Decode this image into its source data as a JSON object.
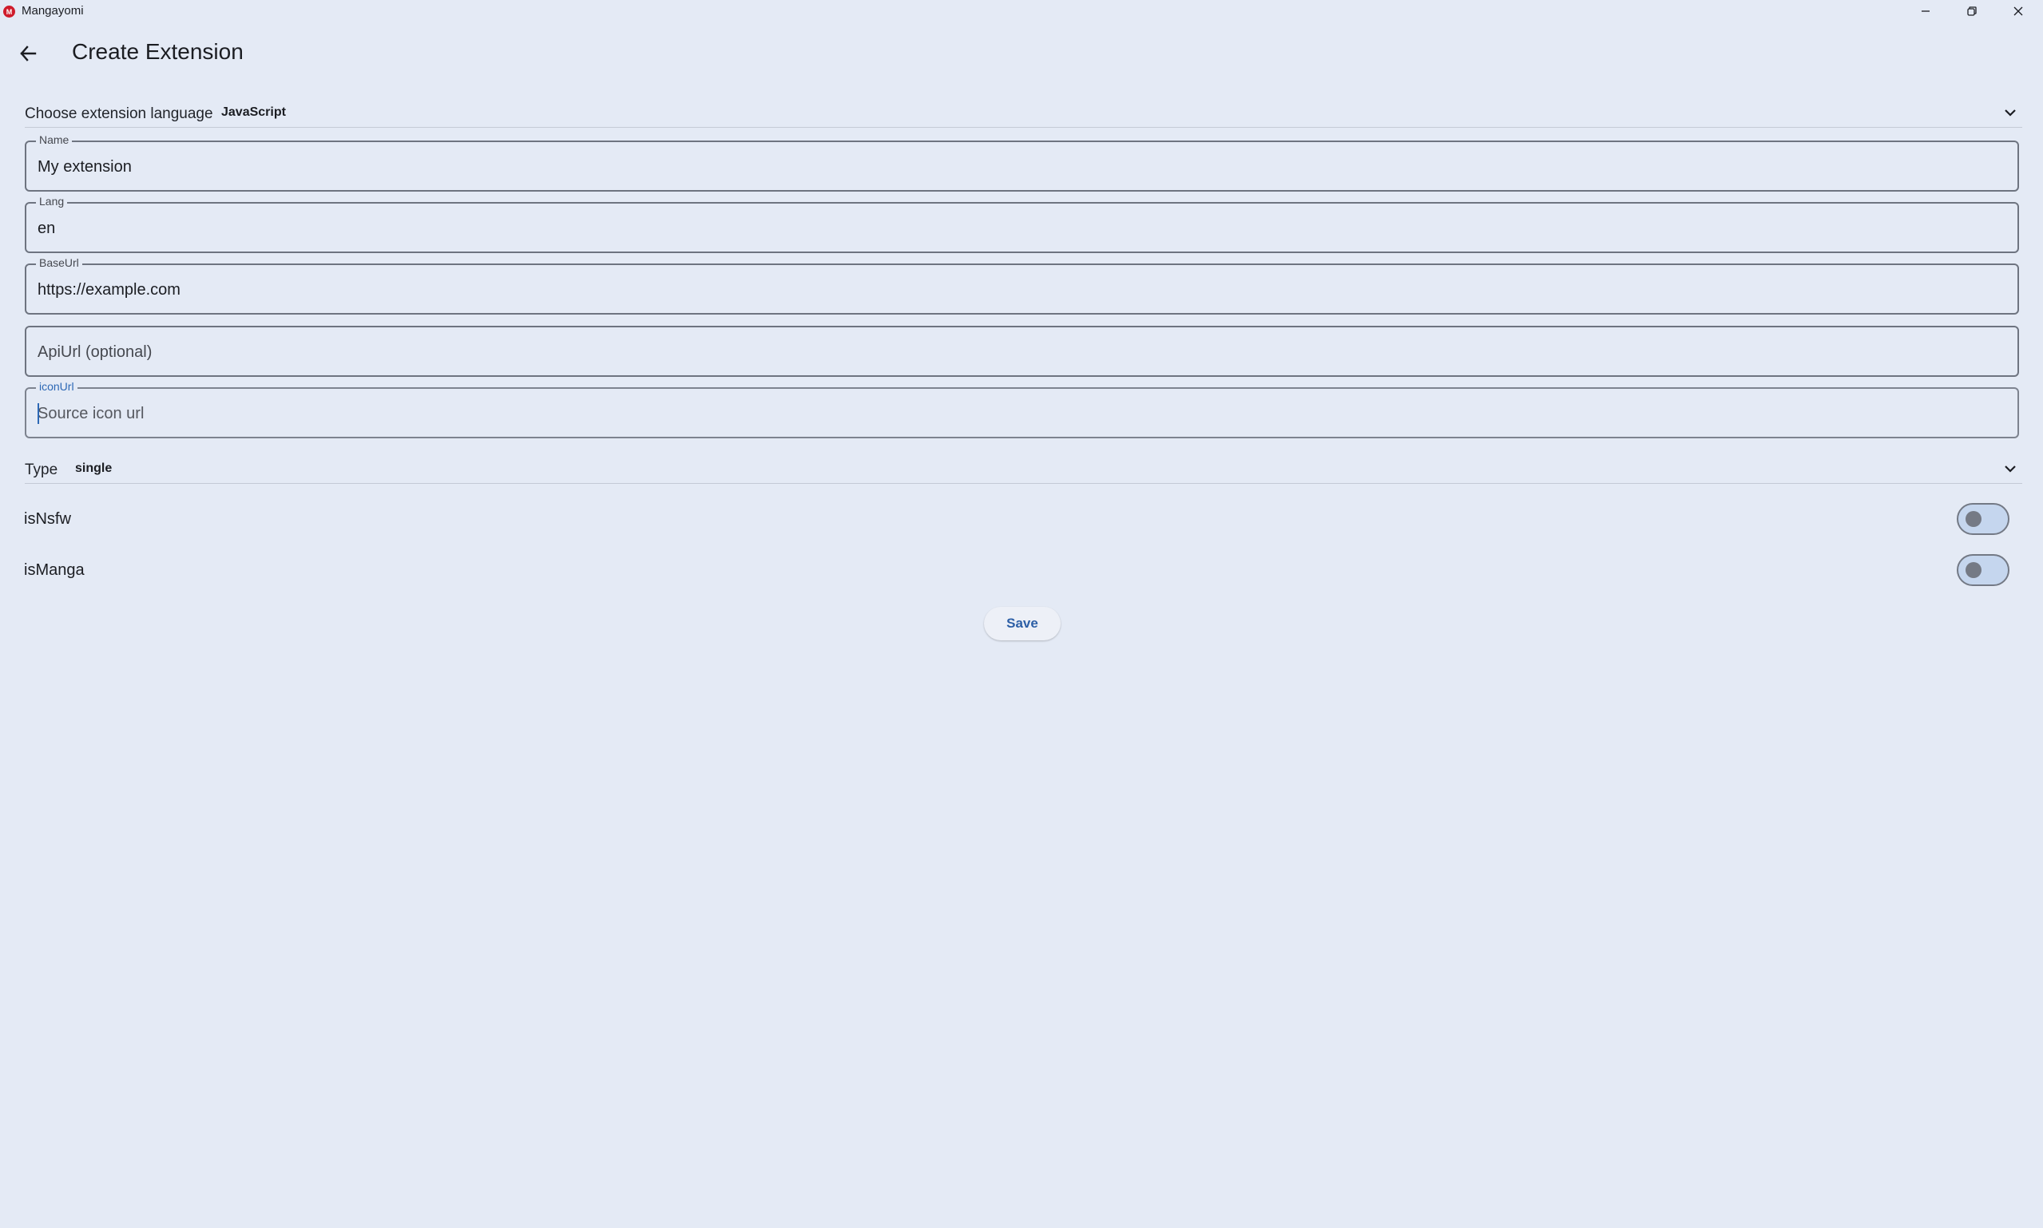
{
  "window": {
    "app_title": "Mangayomi",
    "app_icon_letter": "M"
  },
  "header": {
    "title": "Create Extension"
  },
  "extension_language": {
    "label": "Choose extension language",
    "value": "JavaScript"
  },
  "fields": {
    "name": {
      "label": "Name",
      "value": "My extension"
    },
    "lang": {
      "label": "Lang",
      "value": "en"
    },
    "base_url": {
      "label": "BaseUrl",
      "value": "https://example.com"
    },
    "api_url": {
      "placeholder": "ApiUrl (optional)"
    },
    "icon_url": {
      "label": "iconUrl",
      "placeholder": "Source icon url"
    }
  },
  "type_select": {
    "label": "Type",
    "value": "single"
  },
  "toggles": {
    "is_nsfw": {
      "label": "isNsfw",
      "on": false
    },
    "is_manga": {
      "label": "isManga",
      "on": false
    }
  },
  "actions": {
    "save_label": "Save"
  },
  "colors": {
    "background": "#e4eaf5",
    "accent": "#2d68b5",
    "switch_track": "#c5d6ee",
    "brand": "#cf1b2b"
  },
  "icons": {
    "back": "arrow-left-icon",
    "dropdown": "chevron-down-icon",
    "minimize": "minimize-icon",
    "restore": "restore-icon",
    "close": "close-icon"
  }
}
